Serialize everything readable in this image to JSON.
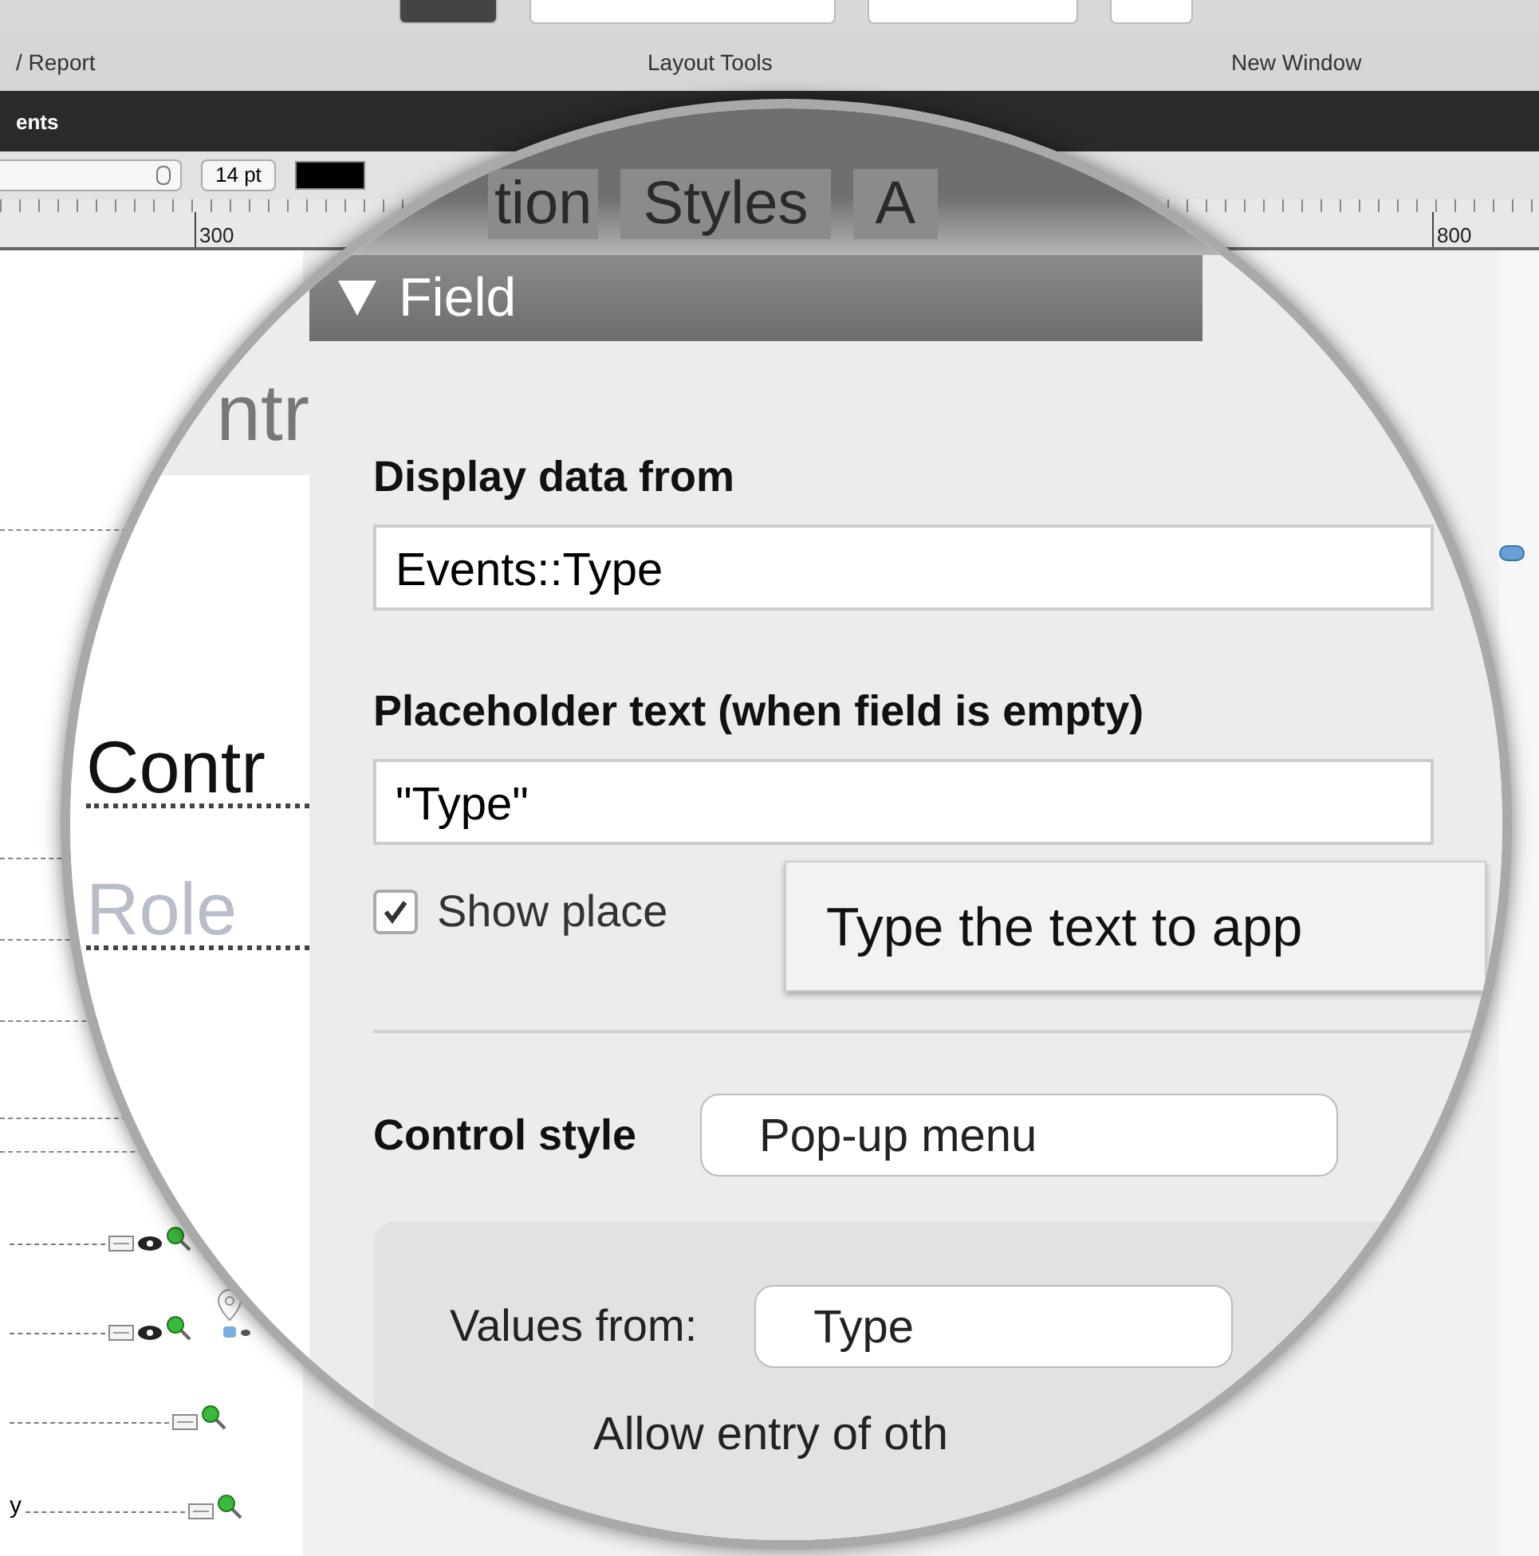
{
  "toolbar_labels": [
    "/ Report",
    "Layout Tools",
    "New Window"
  ],
  "layout_title": "ents",
  "format_bar": {
    "size": "14 pt"
  },
  "ruler": {
    "ticks": [
      "300",
      "800"
    ]
  },
  "canvas_rows": [
    {
      "kind": "viewer"
    },
    {
      "kind": "map"
    },
    {
      "kind": "plain"
    },
    {
      "kind": "plain",
      "text": "y"
    }
  ],
  "magnifier": {
    "tabs": [
      {
        "label": "tion",
        "selected": false
      },
      {
        "label": "Styles",
        "selected": false
      },
      {
        "label": "A",
        "selected": false
      }
    ],
    "layout_heading": "ntr",
    "layout_fields": [
      {
        "text": "Contr",
        "kind": "label"
      },
      {
        "text": "Role",
        "kind": "placeholder"
      }
    ],
    "section": {
      "title": "Field",
      "expanded": true
    },
    "display_label": "Display data from",
    "display_value": "Events::Type",
    "placeholder_label": "Placeholder text (when field is empty)",
    "placeholder_value": "\"Type\"",
    "show_placeholder": {
      "label": "Show place",
      "checked": true
    },
    "tooltip": "Type the text to app",
    "control_style": {
      "label": "Control style",
      "value": "Pop-up menu"
    },
    "values_from": {
      "label": "Values from:",
      "value": "Type"
    },
    "allow_entry": "Allow entry of oth"
  }
}
